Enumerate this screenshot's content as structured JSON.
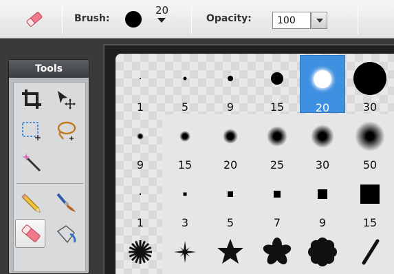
{
  "options_bar": {
    "current_tool_icon": "eraser-icon",
    "brush_label": "Brush:",
    "brush_size": "20",
    "opacity_label": "Opacity:",
    "opacity_value": "100"
  },
  "tools_panel": {
    "title": "Tools",
    "tools": [
      {
        "name": "crop-icon"
      },
      {
        "name": "move-icon"
      },
      {
        "name": "marquee-select-icon"
      },
      {
        "name": "lasso-icon"
      },
      {
        "name": "magic-wand-icon"
      },
      {
        "name": "pencil-icon"
      },
      {
        "name": "brush-icon"
      },
      {
        "name": "eraser-icon",
        "active": true
      },
      {
        "name": "paint-bucket-icon"
      }
    ]
  },
  "brush_picker": {
    "selected": "20",
    "rows": [
      {
        "type": "hard-round",
        "sizes": [
          "1",
          "5",
          "9",
          "15",
          "20",
          "30"
        ]
      },
      {
        "type": "soft-round",
        "sizes": [
          "9",
          "15",
          "20",
          "25",
          "30",
          "50"
        ]
      },
      {
        "type": "square",
        "sizes": [
          "1",
          "3",
          "5",
          "7",
          "9",
          "15"
        ]
      },
      {
        "type": "shapes",
        "items": [
          "starburst-8",
          "starburst-thin",
          "star-5",
          "flower-5",
          "flower-8",
          "slash"
        ]
      }
    ]
  },
  "colors": {
    "selection": "#3e90e0",
    "panel_header": "#3b3e41"
  }
}
